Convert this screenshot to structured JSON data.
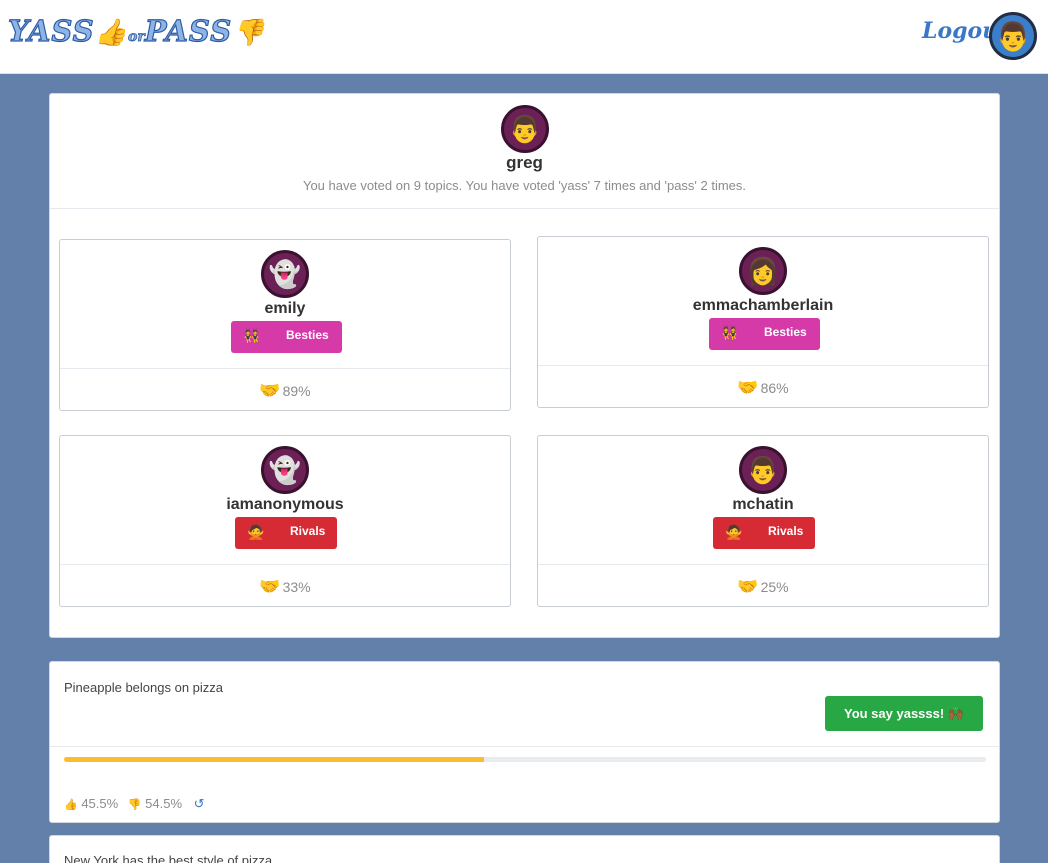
{
  "nav": {
    "logo_yass": "YASS",
    "logo_thumb_up": "👍",
    "logo_or": "or",
    "logo_pass": "PASS",
    "logo_thumb_down": "👎",
    "logout": "Logout",
    "avatar_emoji": "👨"
  },
  "profile": {
    "avatar_emoji": "👨",
    "name": "greg",
    "stats": "You have voted on 9 topics. You have voted 'yass' 7 times and 'pass' 2 times."
  },
  "friends": [
    {
      "name": "emily",
      "avatar": "👻",
      "badge_icon": "👯",
      "badge": "Besties",
      "match": "89%"
    },
    {
      "name": "emmachamberlain",
      "avatar": "👩",
      "badge_icon": "👯",
      "badge": "Besties",
      "match": "86%"
    },
    {
      "name": "iamanonymous",
      "avatar": "👻",
      "badge_icon": "🙅",
      "badge": "Rivals",
      "match": "33%"
    },
    {
      "name": "mchatin",
      "avatar": "👨",
      "badge_icon": "🙅",
      "badge": "Rivals",
      "match": "25%"
    }
  ],
  "topics": [
    {
      "title": "Pineapple belongs on pizza",
      "button": "You say yassss! 🙌🏾",
      "yass_pct": "45.5%",
      "pass_pct": "54.5%",
      "yass_fraction": 0.455
    },
    {
      "title": "New York has the best style of pizza"
    }
  ],
  "icons": {
    "handshake": "🤝",
    "thumbs_up": "👍",
    "thumbs_down": "👎",
    "undo": "↺"
  },
  "colors": {
    "background": "#6380ab",
    "besties": "#d63aa8",
    "rivals": "#d62a34",
    "yass_button": "#28a745",
    "progress": "#fbbd2e"
  }
}
